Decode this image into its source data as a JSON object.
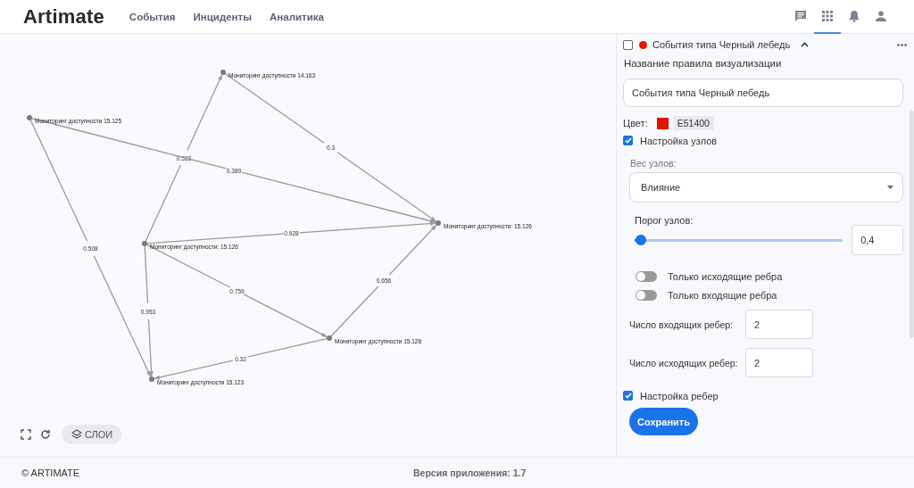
{
  "header": {
    "logo": "Artimate",
    "nav": [
      {
        "label": "События"
      },
      {
        "label": "Инциденты"
      },
      {
        "label": "Аналитика"
      }
    ],
    "icons": [
      {
        "kind": "chat",
        "selected": false
      },
      {
        "kind": "apps",
        "selected": true
      },
      {
        "kind": "bell",
        "selected": false
      },
      {
        "kind": "person",
        "selected": false
      }
    ]
  },
  "graph": {
    "nodes": [
      {
        "label": "Мониторинг доступности 14.163"
      },
      {
        "label": "Мониторинг доступности 15.125"
      },
      {
        "label": "Мониторинг доступности: 15.126"
      },
      {
        "label": "Мониторинг доступности: 15.126"
      },
      {
        "label": "Мониторинг доступности 15.126"
      },
      {
        "label": "Мониторинг доступности 15.123"
      }
    ],
    "edges": [
      {
        "label": "0.523"
      },
      {
        "label": "0.3"
      },
      {
        "label": "0.389"
      },
      {
        "label": "0.928"
      },
      {
        "label": "0.508"
      },
      {
        "label": "0.953"
      },
      {
        "label": "0.759"
      },
      {
        "label": "0.656"
      },
      {
        "label": "0.32"
      }
    ],
    "layers_button": "СЛОИ"
  },
  "rule_panel": {
    "checked": false,
    "color": "#e51400",
    "title": "События типа Черный лебедь",
    "name_label": "Название правила визуализации",
    "name_value": "События типа Черный лебедь",
    "color_label": "Цвет:",
    "color_value": "E51400",
    "node_settings": {
      "label": "Настройка узлов",
      "checked": true
    },
    "weight_label": "Вес узлов:",
    "weight_value": "Влияние",
    "threshold_label": "Порог узлов:",
    "threshold": {
      "level": 0.03
    },
    "threshold_value": "0,4",
    "toggles": [
      {
        "label": "Только исходящие ребра",
        "on": false
      },
      {
        "label": "Только входящие ребра",
        "on": false
      }
    ],
    "counts": [
      {
        "label": "Число входящих ребер:",
        "value": "2"
      },
      {
        "label": "Число исходящих ребер:",
        "value": "2"
      }
    ],
    "edge_settings": {
      "label": "Настройка ребер",
      "checked": true
    },
    "save_button": "Сохранить"
  },
  "footer": {
    "copyright": "© ARTIMATE",
    "version": "Версия приложения: 1.7"
  }
}
